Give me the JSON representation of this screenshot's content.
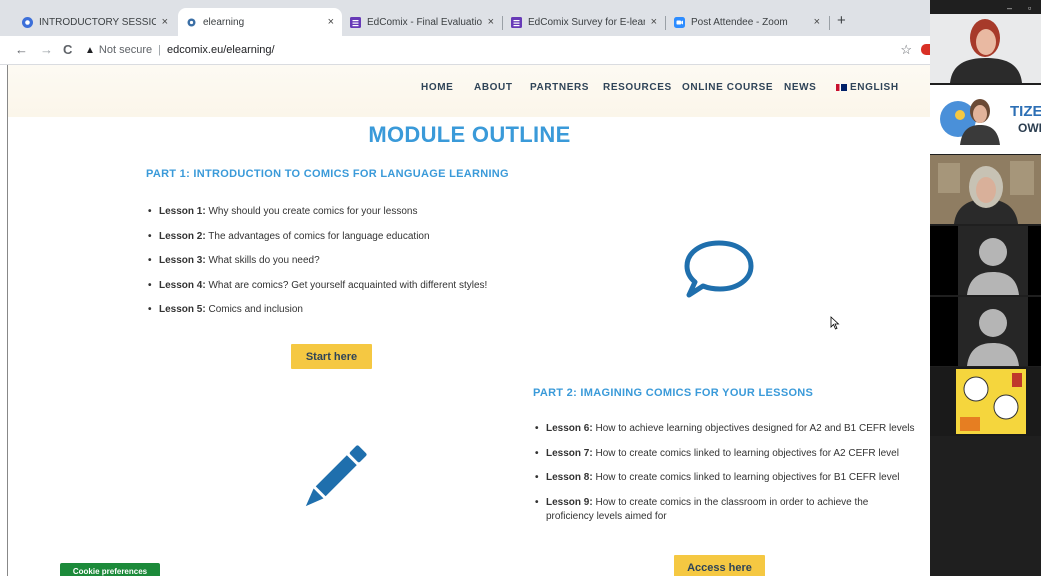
{
  "tabs": [
    {
      "title": "INTRODUCTORY SESSION FOR E",
      "close": "×",
      "active": false,
      "favicon_color": "#3c6fd9"
    },
    {
      "title": "elearning",
      "close": "×",
      "active": true,
      "favicon_color": "#3a6ea5"
    },
    {
      "title": "EdComix - Final Evaluation",
      "close": "×",
      "active": false,
      "favicon_color": "#673ab7"
    },
    {
      "title": "EdComix Survey for E-learning M",
      "close": "×",
      "active": false,
      "favicon_color": "#673ab7"
    },
    {
      "title": "Post Attendee - Zoom",
      "close": "×",
      "active": false,
      "favicon_color": "#2d8cff"
    }
  ],
  "new_tab": "+",
  "address": {
    "warning": "▲",
    "security": "Not secure",
    "separator": "|",
    "url": "edcomix.eu/elearning/"
  },
  "nav": {
    "back": "←",
    "forward": "→",
    "reload": "C",
    "star": "☆"
  },
  "menu": [
    "HOME",
    "ABOUT",
    "PARTNERS",
    "RESOURCES",
    "ONLINE COURSE",
    "NEWS"
  ],
  "language": "ENGLISH",
  "module_title": "MODULE OUTLINE",
  "part1": {
    "title": "PART 1: INTRODUCTION TO COMICS FOR LANGUAGE LEARNING",
    "lessons": [
      {
        "label": "Lesson 1:",
        "text": " Why should you create comics for your lessons"
      },
      {
        "label": "Lesson 2:",
        "text": " The advantages of comics for language education"
      },
      {
        "label": "Lesson 3:",
        "text": " What skills do you need?"
      },
      {
        "label": "Lesson 4:",
        "text": " What are comics? Get yourself acquainted with different styles!"
      },
      {
        "label": "Lesson 5:",
        "text": " Comics and inclusion"
      }
    ],
    "button": "Start here"
  },
  "part2": {
    "title": "PART 2: IMAGINING COMICS FOR YOUR LESSONS",
    "lessons": [
      {
        "label": "Lesson 6:",
        "text": " How to achieve learning objectives designed for A2 and B1 CEFR levels"
      },
      {
        "label": "Lesson 7:",
        "text": " How to create comics linked to learning objectives for A2 CEFR level"
      },
      {
        "label": "Lesson 8:",
        "text": " How to create comics linked to learning objectives for B1 CEFR level"
      },
      {
        "label": "Lesson 9:",
        "text": " How to create comics in the classroom in order to achieve the proficiency levels aimed for"
      }
    ],
    "button": "Access here"
  },
  "cookie": "Cookie preferences",
  "zoom_panel": {
    "minimize": "–",
    "restore": "▫",
    "logo_text_top": "TIZEN",
    "logo_text_bottom": "OWE"
  },
  "colors": {
    "accent": "#3a9ad9",
    "button": "#f5c842",
    "cookie": "#1c8a3a",
    "nav_text": "#2f4458"
  }
}
